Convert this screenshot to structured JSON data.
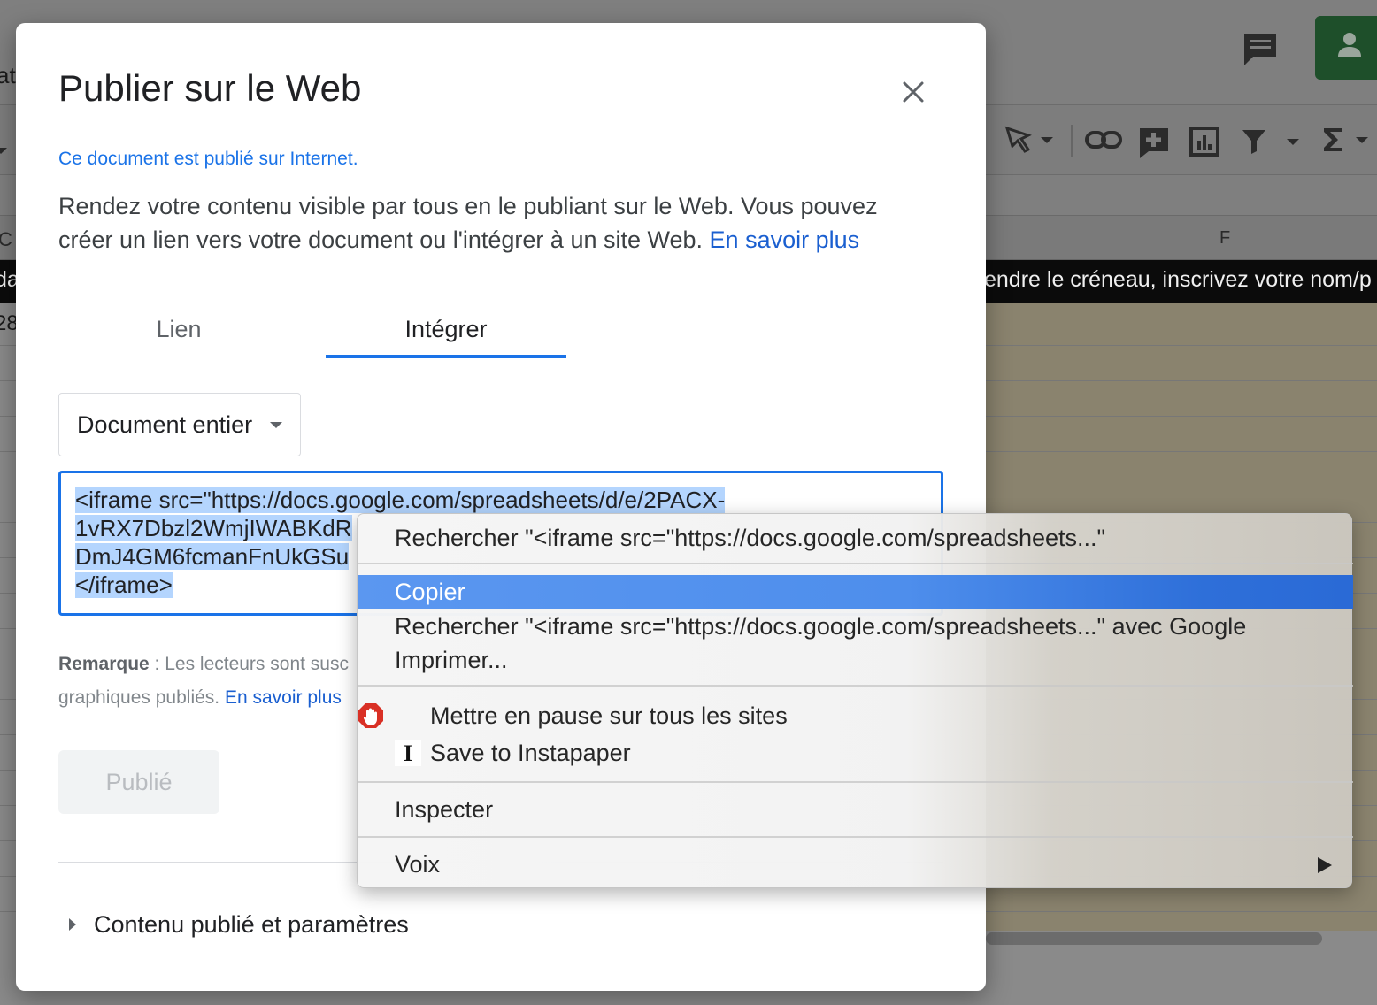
{
  "dialog": {
    "title": "Publier sur le Web",
    "status": "Ce document est publié sur Internet.",
    "description": "Rendez votre contenu visible par tous en le publiant sur le Web. Vous pouvez créer un lien vers votre document ou l'intégrer à un site Web.",
    "learn_more": "En savoir plus",
    "tabs": [
      {
        "label": "Lien",
        "active": false
      },
      {
        "label": "Intégrer",
        "active": true
      }
    ],
    "scope_select": "Document entier",
    "embed_code": {
      "line1": "<iframe src=\"https://docs.google.com/spreadsheets/d/e/2PACX-",
      "line2": "1vRX7Dbzl2WmjIWABKdR",
      "line3": "DmJ4GM6fcmanFnUkGSu",
      "line4": "</iframe>"
    },
    "note_label": "Remarque",
    "note_text": " : Les lecteurs sont susc",
    "note_text2": "graphiques publiés.",
    "note_link": "En savoir plus",
    "publish_button": "Publié",
    "settings_toggle": "Contenu publié et paramètres"
  },
  "context_menu": {
    "items": [
      {
        "label": "Rechercher \"<iframe src=\"https://docs.google.com/spreadsheets...\""
      },
      {
        "label": "Copier",
        "active": true
      },
      {
        "label": "Rechercher \"<iframe src=\"https://docs.google.com/spreadsheets...\" avec Google"
      },
      {
        "label": "Imprimer..."
      },
      {
        "label": "Mettre en pause sur tous les sites",
        "icon": "adblock-stop-icon"
      },
      {
        "label": "Save to Instapaper",
        "icon": "instapaper-icon"
      },
      {
        "label": "Inspecter"
      },
      {
        "label": "Voix",
        "submenu": true
      }
    ]
  },
  "background": {
    "col_header_c": "C",
    "col_header_f": "F",
    "black_row_text": "endre le créneau, inscrivez votre nom/p",
    "black_row_left": "da",
    "row_number": "28",
    "left_edge_text": "at"
  },
  "colors": {
    "accent": "#1a73e8",
    "menu_highlight": "#4e8eec",
    "share_button": "#1e4f2a"
  }
}
